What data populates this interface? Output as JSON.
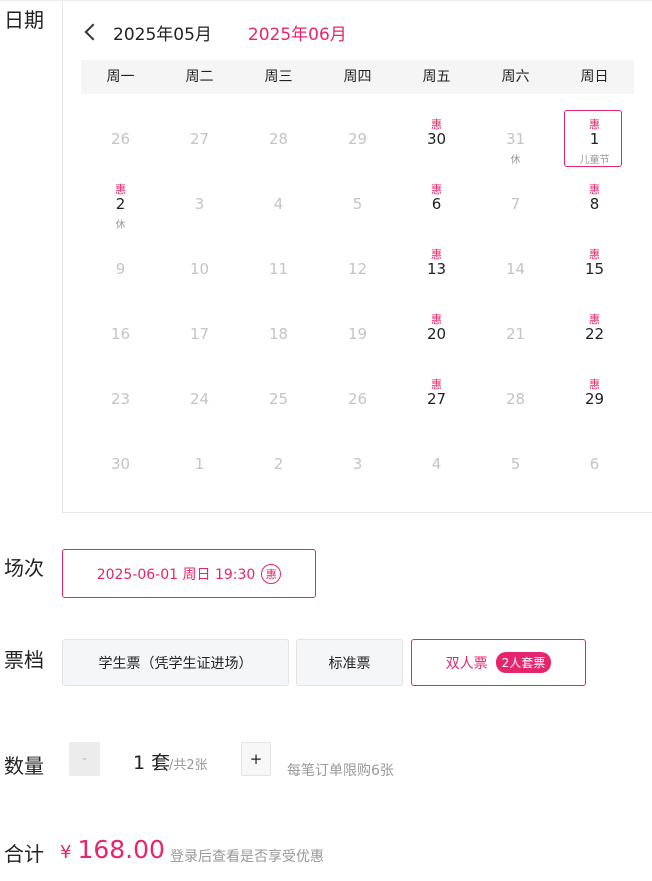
{
  "labels": {
    "date": "日期",
    "session": "场次",
    "tier": "票档",
    "quantity": "数量",
    "total": "合计"
  },
  "calendar": {
    "prev_month": "2025年05月",
    "current_month": "2025年06月",
    "weekdays": [
      "周一",
      "周二",
      "周三",
      "周四",
      "周五",
      "周六",
      "周日"
    ],
    "days": [
      {
        "num": "26",
        "dim": true,
        "hui": "",
        "sub": ""
      },
      {
        "num": "27",
        "dim": true,
        "hui": "",
        "sub": ""
      },
      {
        "num": "28",
        "dim": true,
        "hui": "",
        "sub": ""
      },
      {
        "num": "29",
        "dim": true,
        "hui": "",
        "sub": ""
      },
      {
        "num": "30",
        "dim": false,
        "hui": "惠",
        "sub": ""
      },
      {
        "num": "31",
        "dim": true,
        "hui": "",
        "sub": "休"
      },
      {
        "num": "1",
        "dim": false,
        "hui": "惠",
        "sub": "儿童节",
        "selected": true
      },
      {
        "num": "2",
        "dim": false,
        "hui": "惠",
        "sub": "休"
      },
      {
        "num": "3",
        "dim": true,
        "hui": "",
        "sub": ""
      },
      {
        "num": "4",
        "dim": true,
        "hui": "",
        "sub": ""
      },
      {
        "num": "5",
        "dim": true,
        "hui": "",
        "sub": ""
      },
      {
        "num": "6",
        "dim": false,
        "hui": "惠",
        "sub": ""
      },
      {
        "num": "7",
        "dim": true,
        "hui": "",
        "sub": ""
      },
      {
        "num": "8",
        "dim": false,
        "hui": "惠",
        "sub": ""
      },
      {
        "num": "9",
        "dim": true,
        "hui": "",
        "sub": ""
      },
      {
        "num": "10",
        "dim": true,
        "hui": "",
        "sub": ""
      },
      {
        "num": "11",
        "dim": true,
        "hui": "",
        "sub": ""
      },
      {
        "num": "12",
        "dim": true,
        "hui": "",
        "sub": ""
      },
      {
        "num": "13",
        "dim": false,
        "hui": "惠",
        "sub": ""
      },
      {
        "num": "14",
        "dim": true,
        "hui": "",
        "sub": ""
      },
      {
        "num": "15",
        "dim": false,
        "hui": "惠",
        "sub": ""
      },
      {
        "num": "16",
        "dim": true,
        "hui": "",
        "sub": ""
      },
      {
        "num": "17",
        "dim": true,
        "hui": "",
        "sub": ""
      },
      {
        "num": "18",
        "dim": true,
        "hui": "",
        "sub": ""
      },
      {
        "num": "19",
        "dim": true,
        "hui": "",
        "sub": ""
      },
      {
        "num": "20",
        "dim": false,
        "hui": "惠",
        "sub": ""
      },
      {
        "num": "21",
        "dim": true,
        "hui": "",
        "sub": ""
      },
      {
        "num": "22",
        "dim": false,
        "hui": "惠",
        "sub": ""
      },
      {
        "num": "23",
        "dim": true,
        "hui": "",
        "sub": ""
      },
      {
        "num": "24",
        "dim": true,
        "hui": "",
        "sub": ""
      },
      {
        "num": "25",
        "dim": true,
        "hui": "",
        "sub": ""
      },
      {
        "num": "26",
        "dim": true,
        "hui": "",
        "sub": ""
      },
      {
        "num": "27",
        "dim": false,
        "hui": "惠",
        "sub": ""
      },
      {
        "num": "28",
        "dim": true,
        "hui": "",
        "sub": ""
      },
      {
        "num": "29",
        "dim": false,
        "hui": "惠",
        "sub": ""
      },
      {
        "num": "30",
        "dim": true,
        "hui": "",
        "sub": ""
      },
      {
        "num": "1",
        "dim": true,
        "hui": "",
        "sub": ""
      },
      {
        "num": "2",
        "dim": true,
        "hui": "",
        "sub": ""
      },
      {
        "num": "3",
        "dim": true,
        "hui": "",
        "sub": ""
      },
      {
        "num": "4",
        "dim": true,
        "hui": "",
        "sub": ""
      },
      {
        "num": "5",
        "dim": true,
        "hui": "",
        "sub": ""
      },
      {
        "num": "6",
        "dim": true,
        "hui": "",
        "sub": ""
      }
    ]
  },
  "session": {
    "label": "2025-06-01 周日 19:30",
    "badge": "惠"
  },
  "tiers": [
    {
      "label": "学生票（凭学生证进场）",
      "badge": "",
      "active": false
    },
    {
      "label": "标准票",
      "badge": "",
      "active": false
    },
    {
      "label": "双人票",
      "badge": "2人套票",
      "active": true
    }
  ],
  "quantity": {
    "minus": "-",
    "value": "1 套",
    "total": "/共2张",
    "plus": "+",
    "limit": "每笔订单限购6张"
  },
  "total": {
    "currency": "¥",
    "amount": "168.00",
    "note": "登录后查看是否享受优惠"
  },
  "colors": {
    "accent": "#e5266e"
  }
}
